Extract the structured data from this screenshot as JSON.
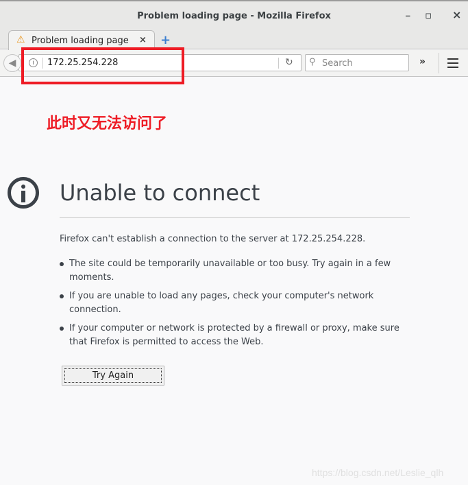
{
  "window": {
    "title": "Problem loading page - Mozilla Firefox",
    "minimize": "_",
    "maximize": "▫",
    "close": "×"
  },
  "tab": {
    "label": "Problem loading page",
    "close": "×",
    "new_tab": "+"
  },
  "toolbar": {
    "url": "172.25.254.228",
    "search_placeholder": "Search",
    "overflow": "»"
  },
  "annotation": {
    "text": "此时又无法访问了",
    "color": "#ee1c25"
  },
  "error": {
    "title": "Unable to connect",
    "description": "Firefox can't establish a connection to the server at 172.25.254.228.",
    "bullets": [
      "The site could be temporarily unavailable or too busy. Try again in a few moments.",
      "If you are unable to load any pages, check your computer's network connection.",
      "If your computer or network is protected by a firewall or proxy, make sure that Firefox is permitted to access the Web."
    ],
    "try_again": "Try Again"
  },
  "watermark": "https://blog.csdn.net/Leslie_qlh"
}
